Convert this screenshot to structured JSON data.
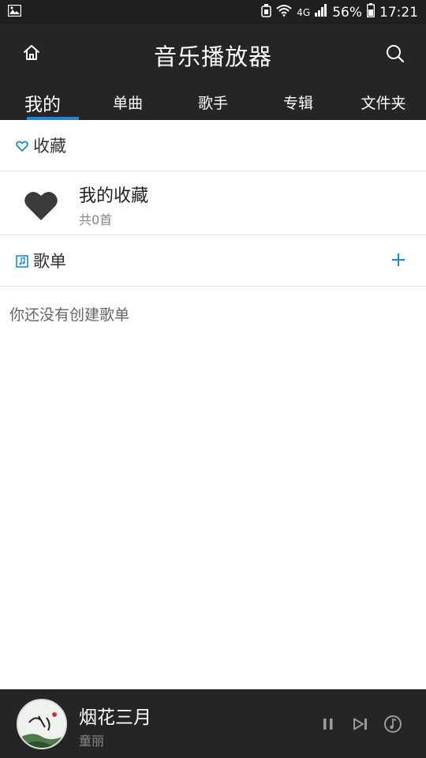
{
  "status_bar": {
    "battery_percent": "56%",
    "time": "17:21",
    "network": "4G"
  },
  "app_bar": {
    "title": "音乐播放器"
  },
  "tabs": [
    {
      "label": "我的"
    },
    {
      "label": "单曲"
    },
    {
      "label": "歌手"
    },
    {
      "label": "专辑"
    },
    {
      "label": "文件夹"
    }
  ],
  "favorites": {
    "header": "收藏",
    "item_title": "我的收藏",
    "item_count": "共0首"
  },
  "playlists": {
    "header": "歌单",
    "empty_text": "你还没有创建歌单"
  },
  "now_playing": {
    "title": "烟花三月",
    "artist": "童丽"
  },
  "colors": {
    "accent": "#1e88d8",
    "bar_bg": "#252525",
    "status_bg": "#1f1f1f"
  }
}
